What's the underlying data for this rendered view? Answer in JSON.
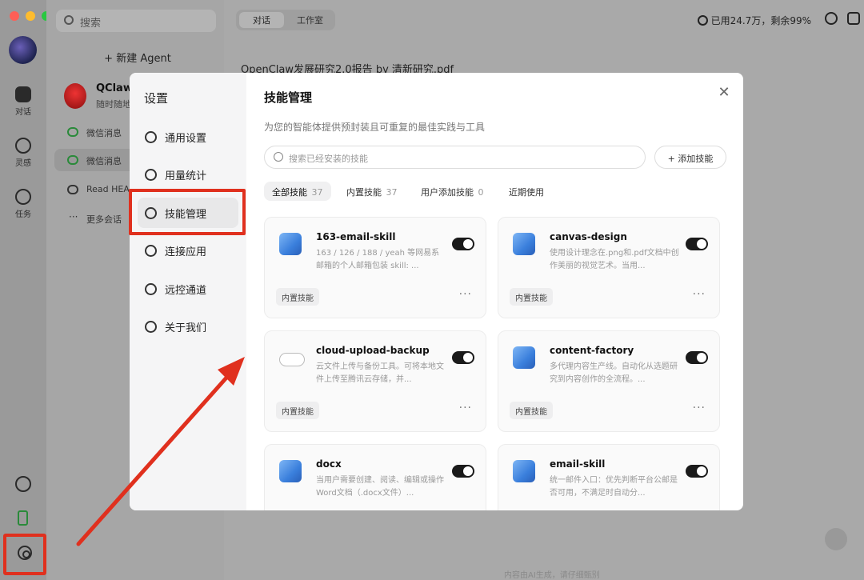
{
  "rail": {
    "items": [
      {
        "label": "对话"
      },
      {
        "label": "灵感"
      },
      {
        "label": "任务"
      }
    ]
  },
  "sessions": {
    "search_placeholder": "搜索",
    "new_agent": "+  新建 Agent",
    "agent_name": "QClaw",
    "agent_sub": "随时随地",
    "items": [
      {
        "label": "微信消息"
      },
      {
        "label": "微信消息"
      },
      {
        "label": "Read HEA"
      },
      {
        "label": "更多会话"
      }
    ]
  },
  "header": {
    "tab_chat": "对话",
    "tab_studio": "工作室",
    "usage": "已用24.7万，剩余99%"
  },
  "main": {
    "doc_title": "OpenClaw发展研究2.0报告 by 清新研究.pdf",
    "footer": "内容由AI生成，请仔细甄别"
  },
  "settings": {
    "title": "设置",
    "nav": [
      {
        "label": "通用设置"
      },
      {
        "label": "用量统计"
      },
      {
        "label": "技能管理"
      },
      {
        "label": "连接应用"
      },
      {
        "label": "远控通道"
      },
      {
        "label": "关于我们"
      }
    ]
  },
  "skills": {
    "title": "技能管理",
    "desc": "为您的智能体提供预封装且可重复的最佳实践与工具",
    "search_placeholder": "搜索已经安装的技能",
    "add_button": "+ 添加技能",
    "tabs": [
      {
        "label": "全部技能",
        "count": "37"
      },
      {
        "label": "内置技能",
        "count": "37"
      },
      {
        "label": "用户添加技能",
        "count": "0"
      },
      {
        "label": "近期使用",
        "count": ""
      }
    ],
    "cards": [
      {
        "name": "163-email-skill",
        "desc": "163 / 126 / 188 / yeah 等网易系邮箱的个人邮箱包装 skill: ...",
        "tag": "内置技能",
        "enabled": true,
        "icon": "puzzle-icon"
      },
      {
        "name": "canvas-design",
        "desc": "使用设计理念在.png和.pdf文档中创作美丽的视觉艺术。当用...",
        "tag": "内置技能",
        "enabled": true,
        "icon": "puzzle-icon"
      },
      {
        "name": "cloud-upload-backup",
        "desc": "云文件上传与备份工具。可将本地文件上传至腾讯云存储，并...",
        "tag": "内置技能",
        "enabled": true,
        "icon": "cloud-icon"
      },
      {
        "name": "content-factory",
        "desc": "多代理内容生产线。自动化从选题研究到内容创作的全流程。...",
        "tag": "内置技能",
        "enabled": true,
        "icon": "puzzle-icon"
      },
      {
        "name": "docx",
        "desc": "当用户需要创建、阅读、编辑或操作Word文档（.docx文件）...",
        "tag": "",
        "enabled": true,
        "icon": "puzzle-icon"
      },
      {
        "name": "email-skill",
        "desc": "统一邮件入口：优先判断平台公邮是否可用，不满足时自动分...",
        "tag": "",
        "enabled": true,
        "icon": "puzzle-icon"
      }
    ]
  },
  "colors": {
    "highlight": "#e0301e",
    "toggle_on": "#1a1a1a"
  }
}
